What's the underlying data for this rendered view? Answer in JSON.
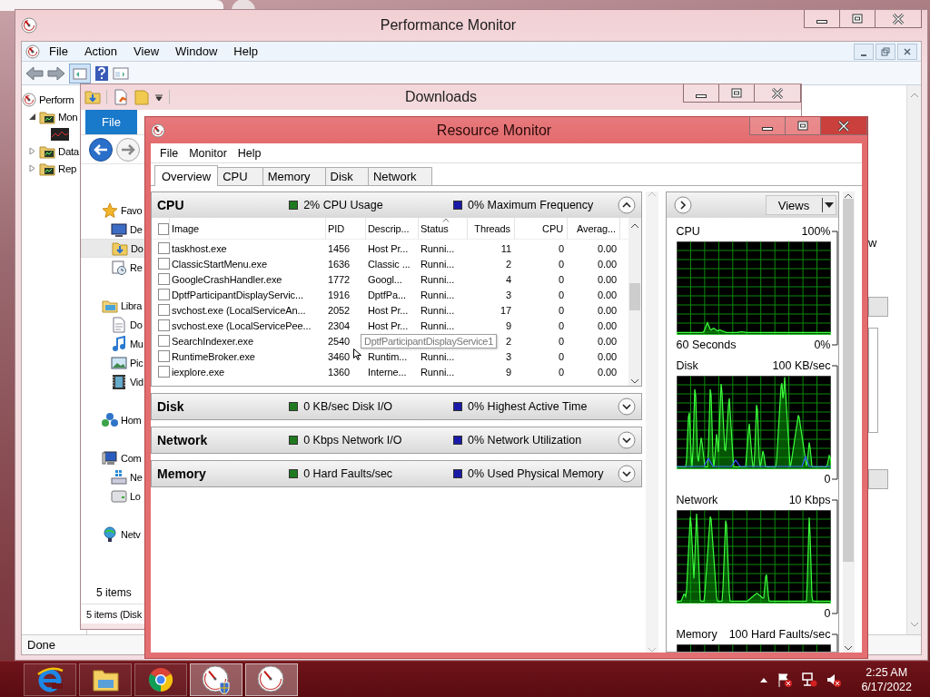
{
  "performance_monitor": {
    "title": "Performance Monitor",
    "menu": [
      "File",
      "Action",
      "View",
      "Window",
      "Help"
    ],
    "tree": [
      {
        "label": "Perform",
        "children": [
          {
            "label": "Mon",
            "expanded": true,
            "children": [
              {
                "kind": "graph"
              }
            ]
          },
          {
            "label": "Data",
            "expanded": false
          },
          {
            "label": "Rep",
            "expanded": false
          }
        ]
      }
    ],
    "side_text": "w",
    "status": "Done"
  },
  "downloads": {
    "title": "Downloads",
    "ribbon_tab": "File",
    "navigation": [
      {
        "label": "Favo",
        "selected": false,
        "children": [
          {
            "label": "De",
            "selected": false
          },
          {
            "label": "Do",
            "selected": true
          },
          {
            "label": "Re",
            "selected": false
          }
        ]
      },
      {
        "label": "Libra",
        "selected": false,
        "children": [
          {
            "label": "Do",
            "selected": false
          },
          {
            "label": "Mu",
            "selected": false
          },
          {
            "label": "Pic",
            "selected": false
          },
          {
            "label": "Vid",
            "selected": false
          }
        ]
      },
      {
        "label": "Hom",
        "selected": false
      },
      {
        "label": "Com",
        "selected": false,
        "children": [
          {
            "label": "Ne",
            "selected": false
          },
          {
            "label": "Lo",
            "selected": false
          }
        ]
      },
      {
        "label": "Netv",
        "selected": false
      }
    ],
    "item_count": "5 items",
    "status": "5 items (Disk"
  },
  "resource_monitor": {
    "title": "Resource Monitor",
    "menu": [
      "File",
      "Monitor",
      "Help"
    ],
    "tabs": [
      {
        "label": "Overview",
        "selected": true
      },
      {
        "label": "CPU",
        "selected": false
      },
      {
        "label": "Memory",
        "selected": false
      },
      {
        "label": "Disk",
        "selected": false
      },
      {
        "label": "Network",
        "selected": false
      }
    ],
    "sections": [
      {
        "title": "CPU",
        "expanded": true,
        "stats": [
          {
            "label": "2% CPU Usage",
            "color": "#1f7a1f"
          },
          {
            "label": "0% Maximum Frequency",
            "color": "#1a1aa8"
          }
        ],
        "table": {
          "select_all_checked": false,
          "columns": [
            {
              "label": "Image",
              "sorted": false
            },
            {
              "label": "PID",
              "sorted": false
            },
            {
              "label": "Descrip...",
              "sorted": false
            },
            {
              "label": "Status",
              "sorted": true
            },
            {
              "label": "Threads",
              "sorted": false
            },
            {
              "label": "CPU",
              "sorted": false
            },
            {
              "label": "Averag...",
              "sorted": false
            }
          ],
          "rows": [
            {
              "checked": false,
              "cells": [
                "taskhost.exe",
                "1456",
                "Host Pr...",
                "Runni...",
                "11",
                "0",
                "0.00"
              ]
            },
            {
              "checked": false,
              "cells": [
                "ClassicStartMenu.exe",
                "1636",
                "Classic ...",
                "Runni...",
                "2",
                "0",
                "0.00"
              ]
            },
            {
              "checked": false,
              "cells": [
                "GoogleCrashHandler.exe",
                "1772",
                "Googl...",
                "Runni...",
                "4",
                "0",
                "0.00"
              ]
            },
            {
              "checked": false,
              "cells": [
                "DptfParticipantDisplayServic...",
                "1916",
                "DptfPa...",
                "Runni...",
                "3",
                "0",
                "0.00"
              ]
            },
            {
              "checked": false,
              "cells": [
                "svchost.exe (LocalServiceAn...",
                "2052",
                "Host Pr...",
                "Runni...",
                "17",
                "0",
                "0.00"
              ]
            },
            {
              "checked": false,
              "cells": [
                "svchost.exe (LocalServicePee...",
                "2304",
                "Host Pr...",
                "Runni...",
                "9",
                "0",
                "0.00"
              ]
            },
            {
              "checked": false,
              "cells": [
                "SearchIndexer.exe",
                "2540",
                null,
                null,
                "2",
                "0",
                "0.00"
              ]
            },
            {
              "checked": false,
              "cells": [
                "RuntimeBroker.exe",
                "3460",
                "Runtim...",
                "Runni...",
                "3",
                "0",
                "0.00"
              ]
            },
            {
              "checked": false,
              "cells": [
                "iexplore.exe",
                "1360",
                "Interne...",
                "Runni...",
                "9",
                "0",
                "0.00"
              ]
            }
          ]
        },
        "tooltip": "DptfParticipantDisplayService1"
      },
      {
        "title": "Disk",
        "expanded": false,
        "stats": [
          {
            "label": "0 KB/sec Disk I/O",
            "color": "#1f7a1f"
          },
          {
            "label": "0% Highest Active Time",
            "color": "#1a1aa8"
          }
        ]
      },
      {
        "title": "Network",
        "expanded": false,
        "stats": [
          {
            "label": "0 Kbps Network I/O",
            "color": "#1f7a1f"
          },
          {
            "label": "0% Network Utilization",
            "color": "#1a1aa8"
          }
        ]
      },
      {
        "title": "Memory",
        "expanded": false,
        "stats": [
          {
            "label": "0 Hard Faults/sec",
            "color": "#1f7a1f"
          },
          {
            "label": "0% Used Physical Memory",
            "color": "#1a1aa8"
          }
        ]
      }
    ],
    "views_button": "Views",
    "graphs": [
      {
        "title": "CPU",
        "max": "100%",
        "time": "60 Seconds",
        "min": "0%"
      },
      {
        "title": "Disk",
        "max": "100 KB/sec",
        "min": "0"
      },
      {
        "title": "Network",
        "max": "10 Kbps",
        "min": "0"
      },
      {
        "title": "Memory",
        "max": "100 Hard Faults/sec"
      }
    ]
  },
  "taskbar": {
    "apps": [
      {
        "kind": "e-browser",
        "active": false
      },
      {
        "kind": "folder",
        "active": false
      },
      {
        "kind": "round-browser",
        "active": false
      },
      {
        "kind": "gauge-shield",
        "active": true
      },
      {
        "kind": "gauge",
        "active": true
      }
    ],
    "clock": {
      "time": "2:25 AM",
      "date": "6/17/2022"
    }
  }
}
